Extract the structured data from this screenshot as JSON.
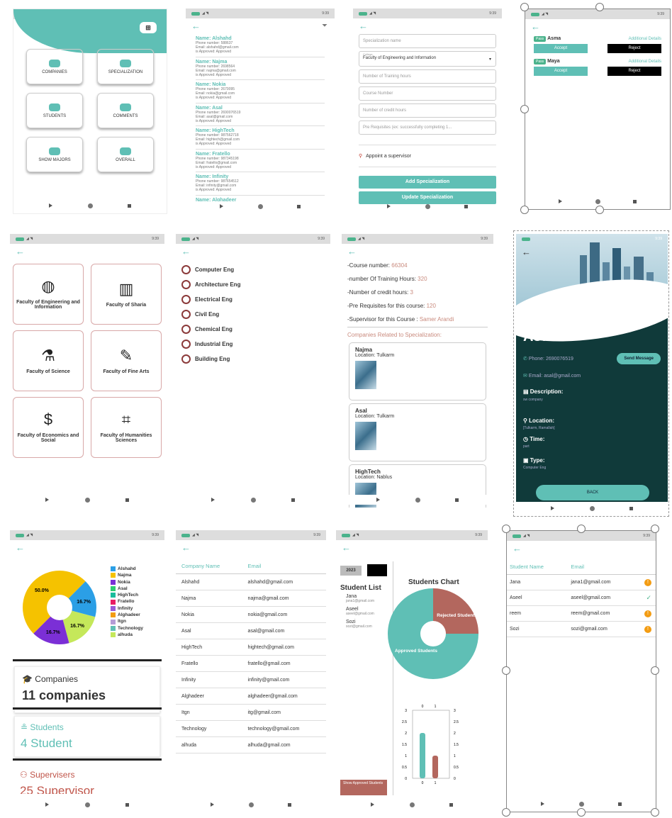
{
  "status": {
    "time": "9:39"
  },
  "s1": {
    "tiles": [
      {
        "label": "COMPANIES"
      },
      {
        "label": "SPECIALIZATION"
      },
      {
        "label": "STUDENTS"
      },
      {
        "label": "COMMENTS"
      },
      {
        "label": "SHOW MAJORS"
      },
      {
        "label": "OVERALL"
      }
    ]
  },
  "s2": {
    "items": [
      {
        "name": "Name: Alshahd",
        "phone": "Phone number: 588637",
        "email": "Email: alshahd@gmail.com",
        "status": "is Approved: Approved"
      },
      {
        "name": "Name: Najma",
        "phone": "Phone number: 2698564",
        "email": "Email: najma@gmail.com",
        "status": "is Approved: Approved"
      },
      {
        "name": "Name: Nokia",
        "phone": "Phone number: 2679095",
        "email": "Email: nokia@gmail.com",
        "status": "is Approved: Approved"
      },
      {
        "name": "Name: Asal",
        "phone": "Phone number: 2690076519",
        "email": "Email: asal@gmail.com",
        "status": "is Approved: Approved"
      },
      {
        "name": "Name: HighTech",
        "phone": "Phone number: 987562718",
        "email": "Email: hightech@gmail.com",
        "status": "is Approved: Approved"
      },
      {
        "name": "Name: Fratello",
        "phone": "Phone number: 987345198",
        "email": "Email: fratello@gmail.com",
        "status": "is Approved: Approved"
      },
      {
        "name": "Name: Infinity",
        "phone": "Phone number: 987654512",
        "email": "Email: infinity@gmail.com",
        "status": "is Approved: Approved"
      },
      {
        "name": "Name: Alghadeer",
        "phone": "",
        "email": "",
        "status": ""
      }
    ]
  },
  "s3": {
    "spec_placeholder": "Specialization name",
    "college_label": "College",
    "college_value": "Faculty of Engineering and Information",
    "hours_placeholder": "Number of Training hours",
    "course_placeholder": "Course Number",
    "credit_placeholder": "Number of credit hours",
    "prereq_placeholder": "Pre Requisites (ex: successfully completing 1...",
    "supervisor": "Appoint a supervisor",
    "add": "Add Specialization",
    "update": "Update Specialization"
  },
  "s4": {
    "rows": [
      {
        "badge": "Pass",
        "name": "Asma",
        "details": "Additional Details",
        "accept": "Accept",
        "reject": "Reject"
      },
      {
        "badge": "Pass",
        "name": "Maya",
        "details": "Additional Details",
        "accept": "Accept",
        "reject": "Reject"
      }
    ]
  },
  "s5": {
    "faculties": [
      {
        "label": "Faculty of Engineering and Information"
      },
      {
        "label": "Faculty of Sharia"
      },
      {
        "label": "Faculty of Science"
      },
      {
        "label": "Faculty of Fine Arts"
      },
      {
        "label": "Faculty of Economics and Social"
      },
      {
        "label": "Faculty of Humanities Sciences"
      }
    ]
  },
  "s6": {
    "majors": [
      "Computer Eng",
      "Architecture Eng",
      "Electrical Eng",
      "Civil Eng",
      "Chemical Eng",
      "Industrial Eng",
      "Building Eng"
    ]
  },
  "s7": {
    "course_label": "-Course number:",
    "course_val": "66304",
    "hours_label": "-number Of Training Hours:",
    "hours_val": "320",
    "credit_label": "-Number of credit hours:",
    "credit_val": "3",
    "prereq_label": "-Pre Requisites for this course:",
    "prereq_val": "120",
    "sup_label": "-Supervisor for this Course :",
    "sup_val": "Samer Arandi",
    "related": "Companies Related to Specialization:",
    "companies": [
      {
        "name": "Najma",
        "loc": "Location: Tulkarm"
      },
      {
        "name": "Asal",
        "loc": "Location: Tulkarm"
      },
      {
        "name": "HighTech",
        "loc": "Location: Nablus"
      }
    ]
  },
  "s8": {
    "name": "Asal",
    "phone": "Phone: 2690076519",
    "send": "Send Message",
    "email": "Email: asal@gmail.com",
    "desc_t": "Description:",
    "desc": "sw company",
    "loc_t": "Location:",
    "loc": "[Tulkarm, Ramallah]",
    "time_t": "Time:",
    "time": "part",
    "type_t": "Type:",
    "type": "Computer Eng",
    "back": "BACK"
  },
  "s9": {
    "legend": [
      "Alshahd",
      "Najma",
      "Nokia",
      "Asal",
      "HighTech",
      "Fratello",
      "Infinity",
      "Alghadeer",
      "Itgn",
      "Technology",
      "alhuda"
    ],
    "legend_colors": [
      "#2b9fe6",
      "#f5c200",
      "#7b2fd6",
      "#2ecc71",
      "#1abc9c",
      "#e91e63",
      "#9b59d6",
      "#f39c12",
      "#b59cd6",
      "#5fbfb5",
      "#c5e85a"
    ],
    "labels": [
      "16.7%",
      "16.7%",
      "50.0%",
      "16.7%"
    ],
    "companies_t": "Companies",
    "companies_v": "11 companies",
    "students_t": "Students",
    "students_v": "4 Student",
    "supervisors_t": "Supervisers",
    "supervisors_v": "25 Supervisor"
  },
  "s10": {
    "headers": [
      "Company Name",
      "Email"
    ],
    "rows": [
      [
        "Alshahd",
        "alshahd@gmail.com"
      ],
      [
        "Najma",
        "najma@gmail.com"
      ],
      [
        "Nokia",
        "nokia@gmail.com"
      ],
      [
        "Asal",
        "asal@gmail.com"
      ],
      [
        "HighTech",
        "hightech@gmail.com"
      ],
      [
        "Fratello",
        "fratello@gmail.com"
      ],
      [
        "Infinity",
        "infinity@gmail.com"
      ],
      [
        "Alghadeer",
        "alghadeer@gmail.com"
      ],
      [
        "Itgn",
        "itg@gmail.com"
      ],
      [
        "Technology",
        "technology@gmail.com"
      ],
      [
        "alhuda",
        "alhuda@gmail.com"
      ]
    ]
  },
  "s11": {
    "year": "2023",
    "list_title": "Student List",
    "students": [
      {
        "name": "Jana",
        "email": "jana1@gmail.com"
      },
      {
        "name": "Aseel",
        "email": "aseel@gmail.com"
      },
      {
        "name": "Sozi",
        "email": "sozi@gmail.com"
      }
    ],
    "chart_title": "Students Chart",
    "rejected": "Rejected Students",
    "approved": "Approved Students",
    "show": "Show Approved Students"
  },
  "s12": {
    "headers": [
      "Student Name",
      "Email"
    ],
    "rows": [
      [
        "Jana",
        "jana1@gmail.com"
      ],
      [
        "Aseel",
        "aseel@gmail.com"
      ],
      [
        "reem",
        "reem@gmail.com"
      ],
      [
        "Sozi",
        "sozi@gmail.com"
      ]
    ]
  },
  "chart_data": [
    {
      "type": "pie",
      "title": "",
      "categories": [
        "Alshahd",
        "Najma",
        "Nokia",
        "Asal",
        "HighTech",
        "Fratello",
        "Infinity",
        "Alghadeer",
        "Itgn",
        "Technology",
        "alhuda"
      ],
      "slices": [
        {
          "label": "50.0%",
          "value": 50.0
        },
        {
          "label": "16.7%",
          "value": 16.7
        },
        {
          "label": "16.7%",
          "value": 16.7
        },
        {
          "label": "16.7%",
          "value": 16.7
        }
      ]
    },
    {
      "type": "pie",
      "title": "Students Chart",
      "categories": [
        "Rejected Students",
        "Approved Students"
      ],
      "values": [
        25,
        75
      ]
    },
    {
      "type": "bar",
      "categories": [
        "0",
        "1"
      ],
      "values": [
        2,
        1
      ],
      "ylim": [
        0,
        3
      ],
      "yticks": [
        "0",
        "0.5",
        "1",
        "1.5",
        "2",
        "2.5",
        "3"
      ]
    }
  ]
}
